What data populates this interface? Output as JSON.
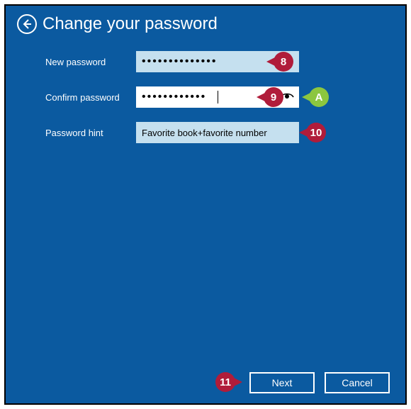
{
  "header": {
    "title": "Change your password"
  },
  "form": {
    "new_password": {
      "label": "New password",
      "value": "••••••••••••••"
    },
    "confirm_password": {
      "label": "Confirm password",
      "value": "••••••••••••"
    },
    "password_hint": {
      "label": "Password hint",
      "value": "Favorite book+favorite number"
    }
  },
  "buttons": {
    "next": "Next",
    "cancel": "Cancel"
  },
  "callouts": {
    "c8": "8",
    "c9": "9",
    "cA": "A",
    "c10": "10",
    "c11": "11"
  }
}
